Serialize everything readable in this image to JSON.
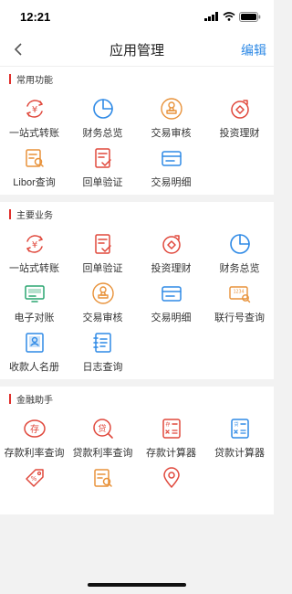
{
  "status": {
    "time": "12:21"
  },
  "nav": {
    "title": "应用管理",
    "edit": "编辑"
  },
  "sections": [
    {
      "title": "常用功能",
      "items": [
        {
          "label": "一站式转账",
          "icon": "yen-exchange"
        },
        {
          "label": "财务总览",
          "icon": "pie"
        },
        {
          "label": "交易审核",
          "icon": "stamp"
        },
        {
          "label": "投资理财",
          "icon": "invest"
        },
        {
          "label": "Libor查询",
          "icon": "doc-search"
        },
        {
          "label": "回单验证",
          "icon": "doc-check"
        },
        {
          "label": "交易明细",
          "icon": "card"
        }
      ]
    },
    {
      "title": "主要业务",
      "items": [
        {
          "label": "一站式转账",
          "icon": "yen-exchange"
        },
        {
          "label": "回单验证",
          "icon": "doc-check"
        },
        {
          "label": "投资理财",
          "icon": "invest"
        },
        {
          "label": "财务总览",
          "icon": "pie"
        },
        {
          "label": "电子对账",
          "icon": "screen"
        },
        {
          "label": "交易审核",
          "icon": "stamp"
        },
        {
          "label": "交易明细",
          "icon": "card"
        },
        {
          "label": "联行号查询",
          "icon": "bank-search"
        },
        {
          "label": "收款人名册",
          "icon": "contacts"
        },
        {
          "label": "日志查询",
          "icon": "log"
        }
      ]
    },
    {
      "title": "金融助手",
      "items": [
        {
          "label": "存款利率查询",
          "icon": "deposit-rate"
        },
        {
          "label": "贷款利率查询",
          "icon": "loan-rate"
        },
        {
          "label": "存款计算器",
          "icon": "deposit-calc"
        },
        {
          "label": "贷款计算器",
          "icon": "loan-calc"
        },
        {
          "label": "",
          "icon": "tag"
        },
        {
          "label": "",
          "icon": "doc-search"
        },
        {
          "label": "",
          "icon": "location"
        }
      ]
    }
  ],
  "colors": {
    "red": "#e0483c",
    "blue": "#2f8ae6",
    "orange": "#e8923a",
    "green": "#2aa570"
  }
}
